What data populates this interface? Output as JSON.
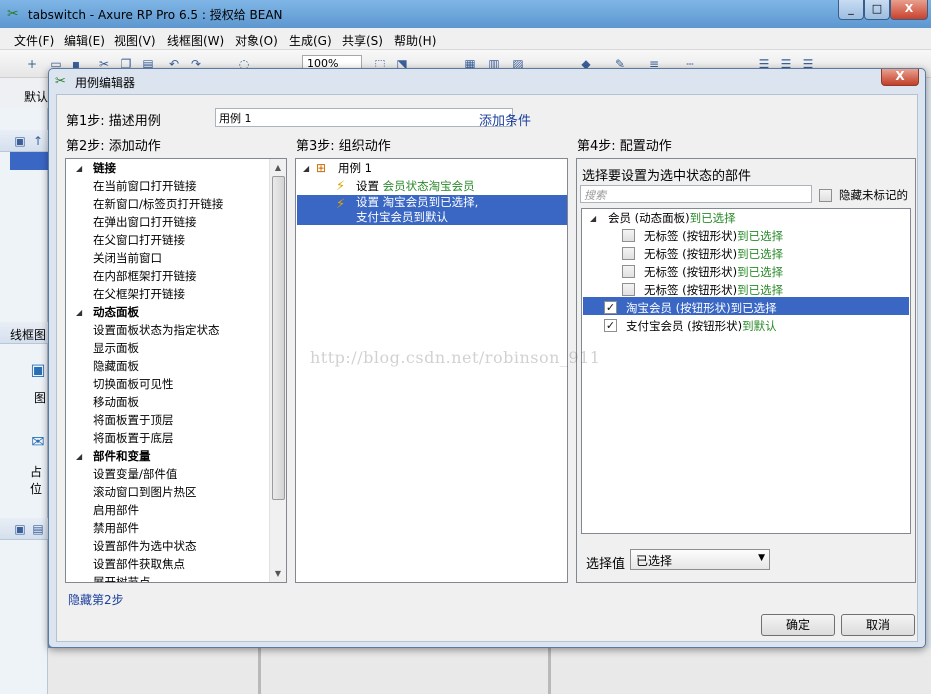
{
  "app": {
    "title": "tabswitch - Axure RP Pro 6.5 : 授权给 BEAN",
    "menu": [
      "文件(F)",
      "编辑(E)",
      "视图(V)",
      "线框图(W)",
      "对象(O)",
      "生成(G)",
      "共享(S)",
      "帮助(H)"
    ],
    "zoom": "100%",
    "toolbar2_label": "默认",
    "left_pane": {
      "wireframe_header": "线框图",
      "item1": "图",
      "item2": "占位"
    }
  },
  "dialog": {
    "title": "用例编辑器",
    "close_label": "X",
    "step1": {
      "label": "第1步: 描述用例",
      "case_name": "用例 1",
      "add_condition": "添加条件"
    },
    "step2": {
      "label": "第2步: 添加动作",
      "groups": [
        {
          "name": "链接",
          "items": [
            "在当前窗口打开链接",
            "在新窗口/标签页打开链接",
            "在弹出窗口打开链接",
            "在父窗口打开链接",
            "关闭当前窗口",
            "在内部框架打开链接",
            "在父框架打开链接"
          ]
        },
        {
          "name": "动态面板",
          "items": [
            "设置面板状态为指定状态",
            "显示面板",
            "隐藏面板",
            "切换面板可见性",
            "移动面板",
            "将面板置于顶层",
            "将面板置于底层"
          ]
        },
        {
          "name": "部件和变量",
          "items": [
            "设置变量/部件值",
            "滚动窗口到图片热区",
            "启用部件",
            "禁用部件",
            "设置部件为选中状态",
            "设置部件获取焦点",
            "展开树节点"
          ]
        }
      ],
      "hide_link": "隐藏第2步"
    },
    "step3": {
      "label": "第3步: 组织动作",
      "case": "用例 1",
      "action1": {
        "verb": "设置",
        "target": "会员状态淘宝会员"
      },
      "action2": {
        "line1": "设置 淘宝会员到已选择,",
        "line2": "支付宝会员到默认"
      }
    },
    "step4": {
      "label": "第4步: 配置动作",
      "prompt": "选择要设置为选中状态的部件",
      "search_placeholder": "搜索",
      "hide_unmarked": "隐藏未标记的",
      "widgets": [
        {
          "name": "会员 (动态面板)",
          "state": "到已选择",
          "checked": false,
          "is_group": true
        },
        {
          "name": "无标签 (按钮形状)",
          "state": "到已选择",
          "checked": false
        },
        {
          "name": "无标签 (按钮形状)",
          "state": "到已选择",
          "checked": false
        },
        {
          "name": "无标签 (按钮形状)",
          "state": "到已选择",
          "checked": false
        },
        {
          "name": "无标签 (按钮形状)",
          "state": "到已选择",
          "checked": false
        },
        {
          "name": "淘宝会员 (按钮形状)",
          "state": "到已选择",
          "checked": true,
          "selected": true
        },
        {
          "name": "支付宝会员 (按钮形状)",
          "state": "到默认",
          "checked": true
        }
      ],
      "select_value_label": "选择值",
      "select_value": "已选择"
    },
    "ok_label": "确定",
    "cancel_label": "取消"
  },
  "watermark": "http://blog.csdn.net/robinson_911"
}
